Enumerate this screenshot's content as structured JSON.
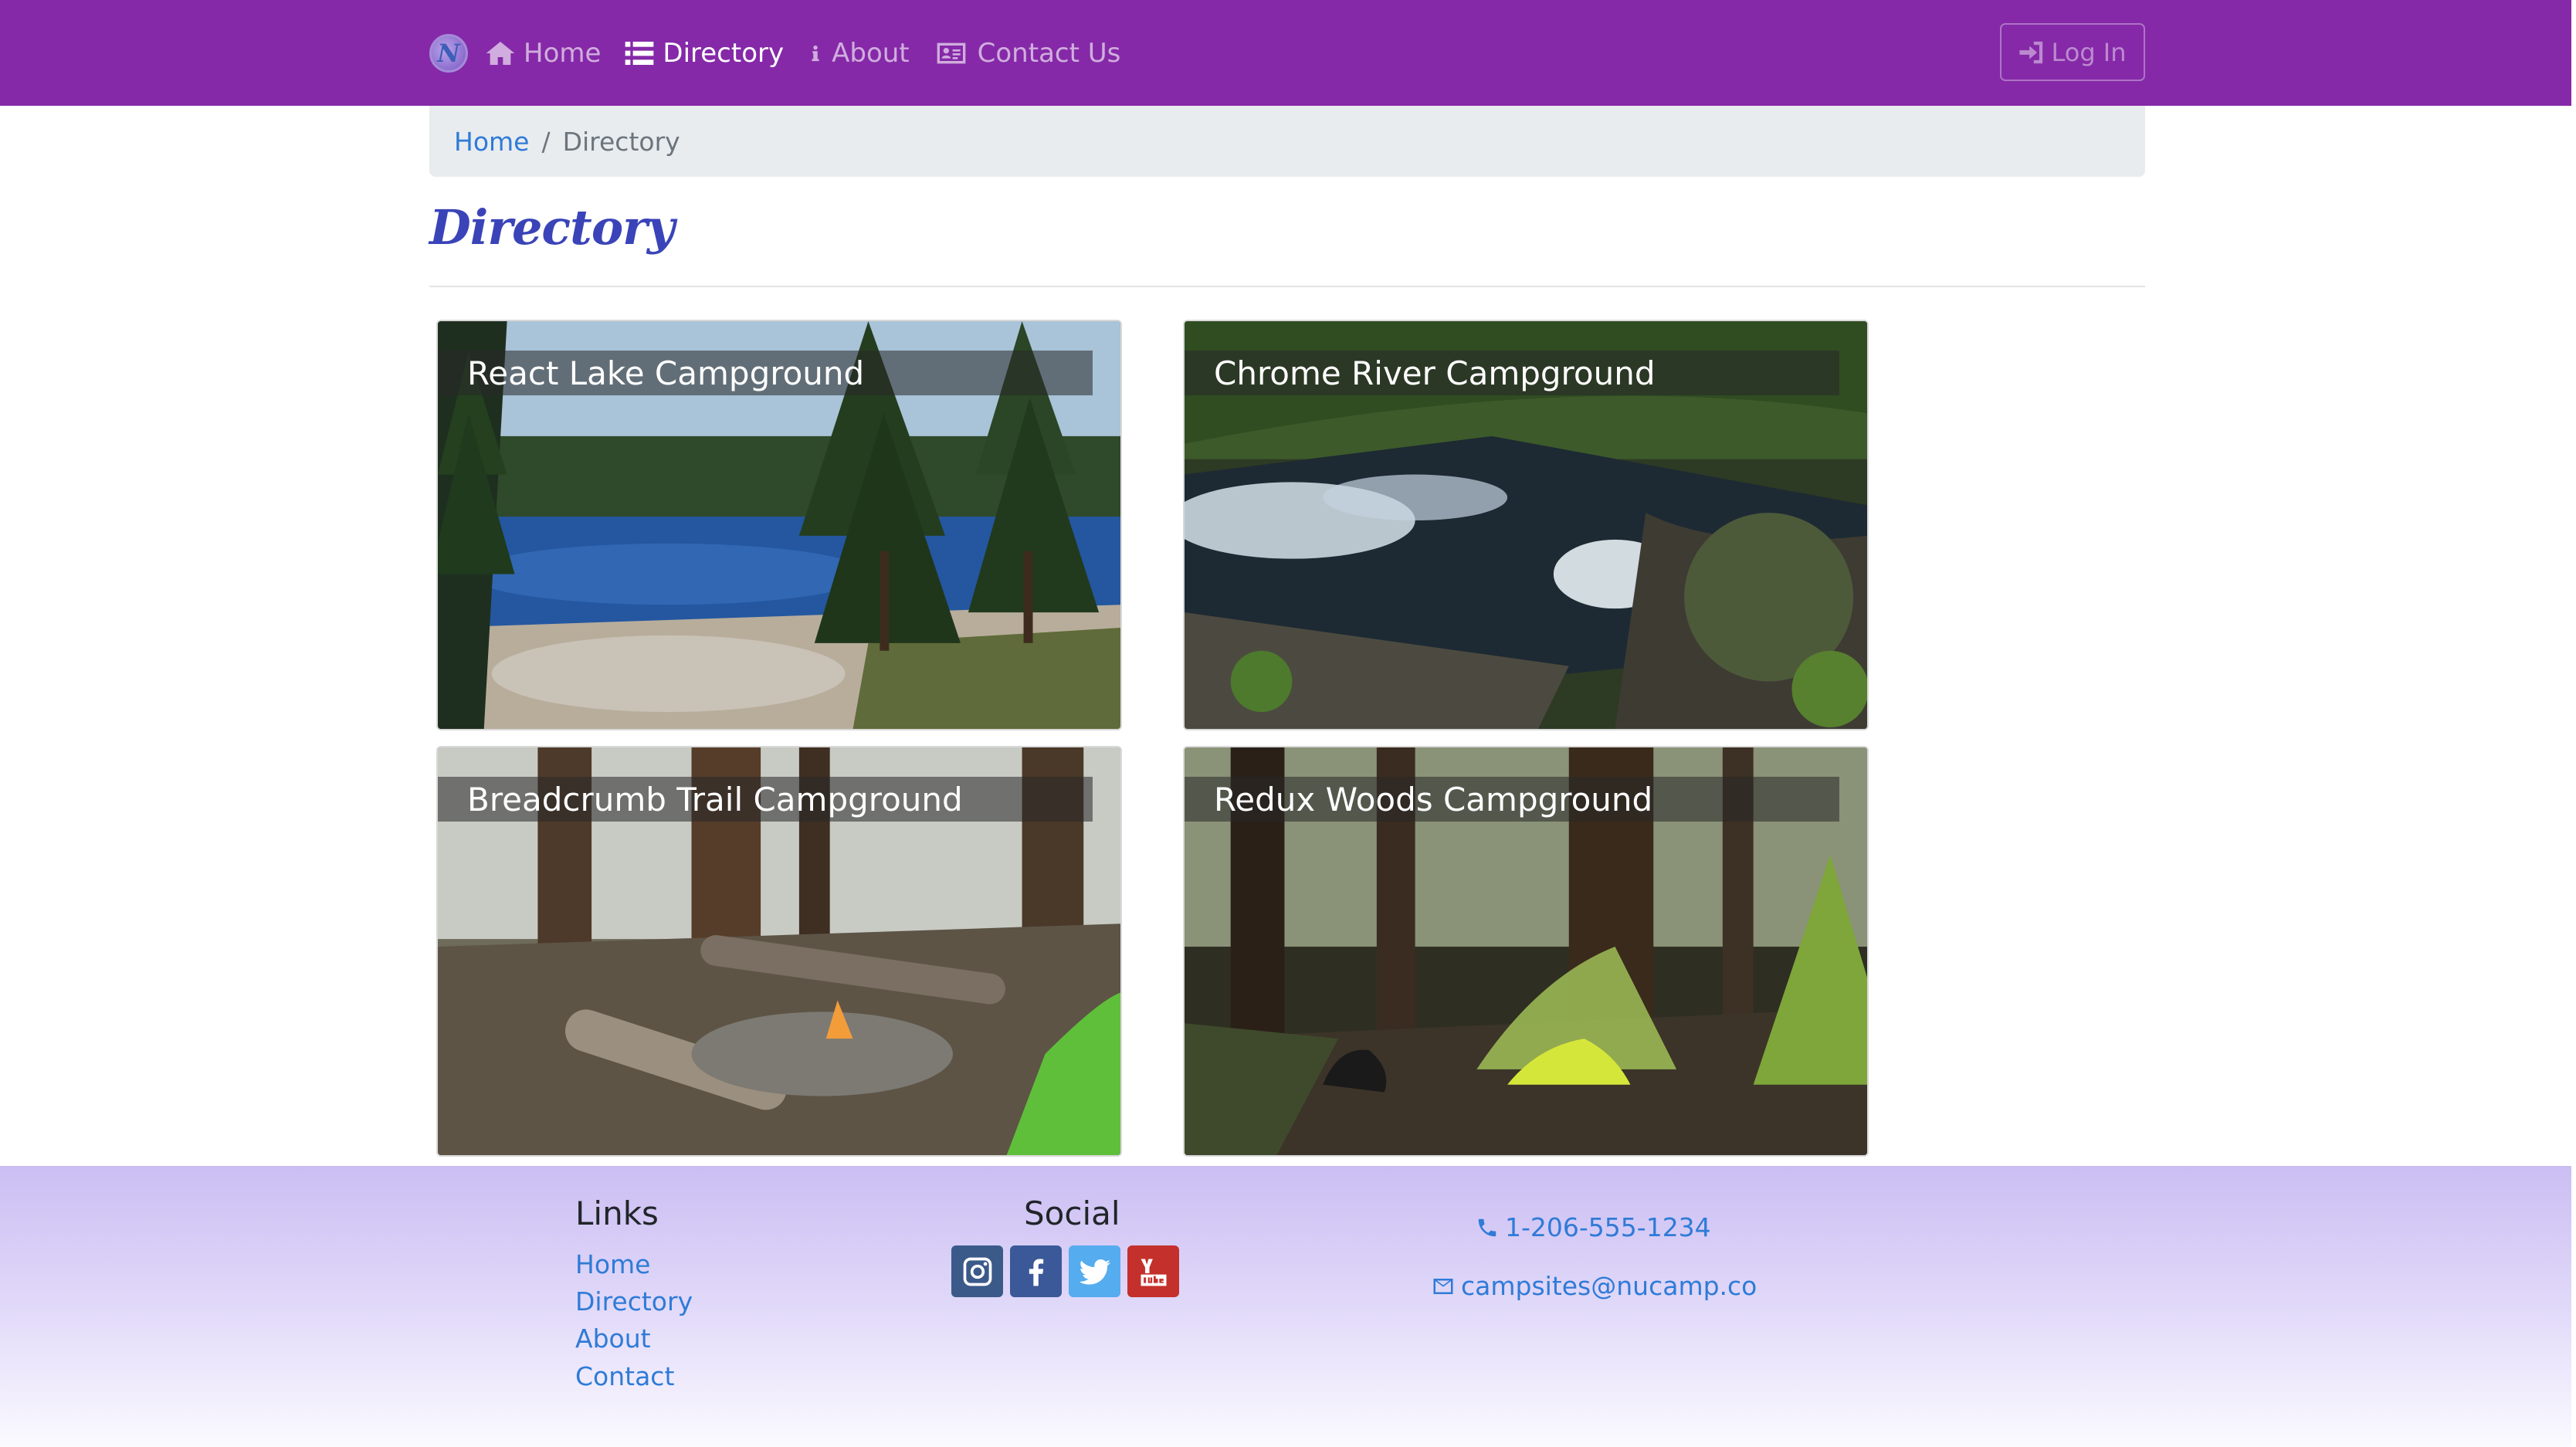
{
  "navbar": {
    "brand_icon": "nucamp-logo",
    "brand_letter": "N",
    "items": [
      {
        "label": "Home",
        "icon": "home-icon"
      },
      {
        "label": "Directory",
        "icon": "list-icon",
        "active": true
      },
      {
        "label": "About",
        "icon": "info-icon"
      },
      {
        "label": "Contact Us",
        "icon": "address-card-icon"
      }
    ],
    "login_label": "Log In",
    "background": "#8529a8"
  },
  "breadcrumb": {
    "home": "Home",
    "separator": "/",
    "current": "Directory"
  },
  "page": {
    "title": "Directory",
    "title_color": "#3a44b8"
  },
  "campsites": [
    {
      "name": "React Lake Campground",
      "image": "lake-with-pine-trees"
    },
    {
      "name": "Chrome River Campground",
      "image": "river-rapids-in-forest"
    },
    {
      "name": "Breadcrumb Trail Campground",
      "image": "campfire-with-logs"
    },
    {
      "name": "Redux Woods Campground",
      "image": "tent-in-forest"
    }
  ],
  "footer": {
    "links_heading": "Links",
    "links": [
      "Home",
      "Directory",
      "About",
      "Contact"
    ],
    "social_heading": "Social",
    "social": [
      {
        "icon": "instagram-icon",
        "color": "#3b5a8a"
      },
      {
        "icon": "facebook-icon",
        "color": "#3b5998"
      },
      {
        "icon": "twitter-icon",
        "color": "#55acee"
      },
      {
        "icon": "youtube-icon",
        "color": "#c4302b"
      }
    ],
    "phone": "1-206-555-1234",
    "email": "campsites@nucamp.co",
    "link_color": "#2f7bd7"
  }
}
